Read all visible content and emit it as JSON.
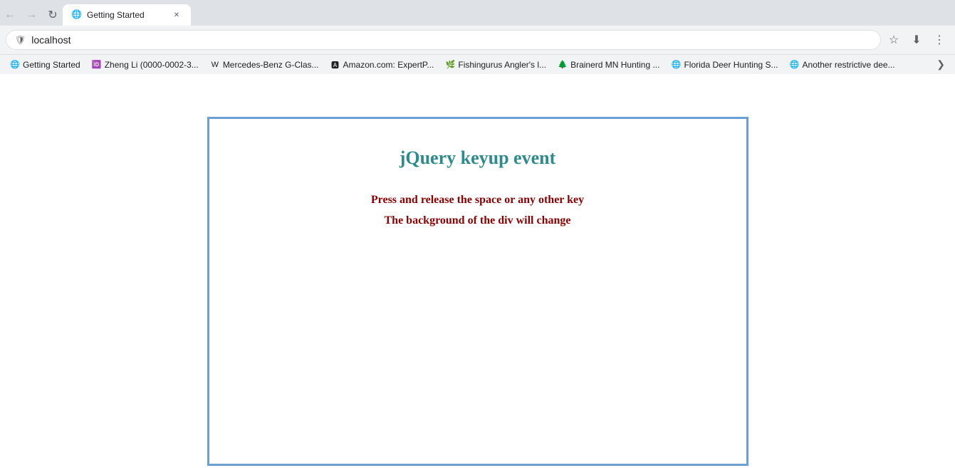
{
  "browser": {
    "url": "localhost",
    "active_tab": {
      "title": "Getting Started",
      "favicon": "🌐"
    }
  },
  "bookmarks": [
    {
      "label": "Getting Started",
      "favicon": "🌐"
    },
    {
      "label": "Zheng Li (0000-0002-3...",
      "favicon": "🆔"
    },
    {
      "label": "Mercedes-Benz G-Clas...",
      "favicon": "W"
    },
    {
      "label": "Amazon.com: ExpertP...",
      "favicon": "🅰"
    },
    {
      "label": "Fishingurus Angler's l...",
      "favicon": "🌿"
    },
    {
      "label": "Brainerd MN Hunting ...",
      "favicon": "🌲"
    },
    {
      "label": "Florida Deer Hunting S...",
      "favicon": "🌐"
    },
    {
      "label": "Another restrictive dee...",
      "favicon": "🌐"
    }
  ],
  "page": {
    "title": "jQuery keyup event",
    "description_line1": "Press and release the space or any other key",
    "description_line2": "The background of the div will change"
  }
}
